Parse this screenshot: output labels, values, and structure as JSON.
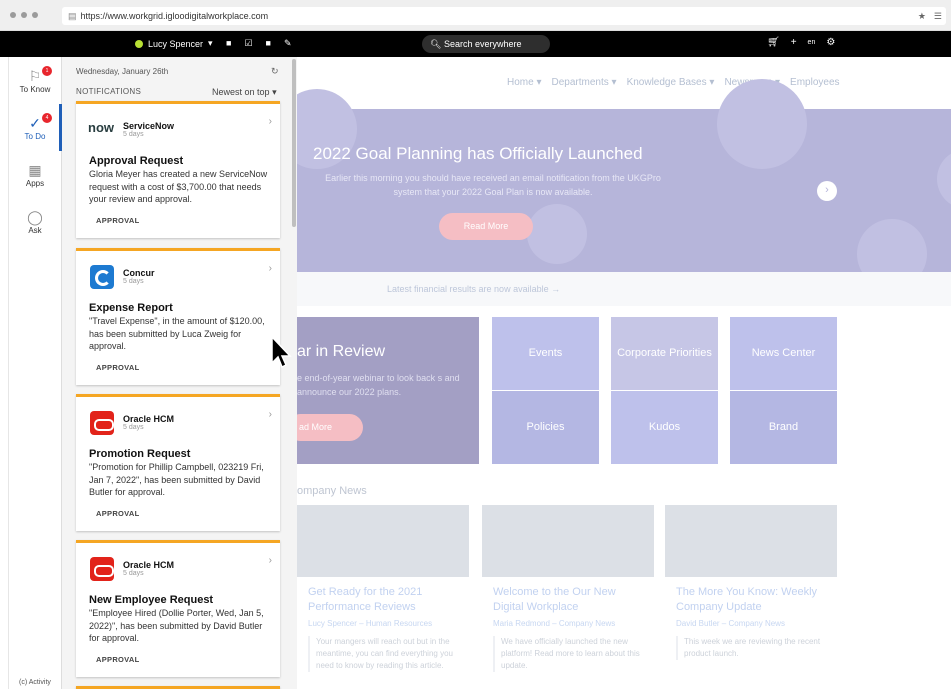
{
  "browser": {
    "url": "https://www.workgrid.igloodigitalworkplace.com"
  },
  "topbar": {
    "user": "Lucy Spencer",
    "search_placeholder": "Search everywhere",
    "lang": "en"
  },
  "sidebar": {
    "items": [
      {
        "label": "To Know",
        "badge": "1"
      },
      {
        "label": "To Do",
        "badge": "4"
      },
      {
        "label": "Apps"
      },
      {
        "label": "Ask"
      }
    ],
    "footer": "(c) Activity"
  },
  "panel": {
    "date": "Wednesday, January 26th",
    "header": "NOTIFICATIONS",
    "sort": "Newest on top",
    "cards": [
      {
        "app": "ServiceNow",
        "age": "5 days",
        "title": "Approval Request",
        "body": "Gloria Meyer has created a new ServiceNow request with a cost of $3,700.00 that needs your review and approval.",
        "tag": "APPROVAL"
      },
      {
        "app": "Concur",
        "age": "5 days",
        "title": "Expense Report",
        "body": "\"Travel Expense\", in the amount of $120.00, has been submitted by Luca Zweig for approval.",
        "tag": "APPROVAL"
      },
      {
        "app": "Oracle HCM",
        "age": "5 days",
        "title": "Promotion Request",
        "body": "\"Promotion for Phillip Campbell, 023219 Fri, Jan 7, 2022\", has been submitted by David Butler for approval.",
        "tag": "APPROVAL"
      },
      {
        "app": "Oracle HCM",
        "age": "5 days",
        "title": "New Employee Request",
        "body": "\"Employee Hired (Dollie Porter, Wed, Jan 5, 2022)\", has been submitted by David Butler for approval.",
        "tag": "APPROVAL"
      }
    ]
  },
  "site": {
    "nav": [
      "Home",
      "Departments",
      "Knowledge Bases",
      "Newsroom",
      "Employees"
    ],
    "hero": {
      "title": "2022 Goal Planning has Officially Launched",
      "text": "Earlier this morning you should have received an email notification from the UKGPro system that your 2022 Goal Plan is now available.",
      "button": "Read More"
    },
    "finance": "Latest financial results are now available →",
    "review": {
      "title": "ar in Review",
      "text": "e end-of-year webinar to look back s and announce our 2022 plans.",
      "button": "ad More"
    },
    "tiles": [
      "Events",
      "Corporate Priorities",
      "News Center",
      "Policies",
      "Kudos",
      "Brand"
    ],
    "company_news": "ompany News",
    "news": [
      {
        "title": "Get Ready for the 2021 Performance Reviews",
        "by": "Lucy Spencer",
        "dept": "Human Resources",
        "excerpt": "Your mangers will reach out but in the meantime, you can find everything you need to know by reading this article."
      },
      {
        "title": "Welcome to the Our New Digital Workplace",
        "by": "Maria Redmond",
        "dept": "Company News",
        "excerpt": "We have officially launched the new platform! Read more to learn about this update."
      },
      {
        "title": "The More You Know: Weekly Company Update",
        "by": "David Butler",
        "dept": "Company News",
        "excerpt": "This week we are reviewing the recent product launch."
      }
    ]
  }
}
